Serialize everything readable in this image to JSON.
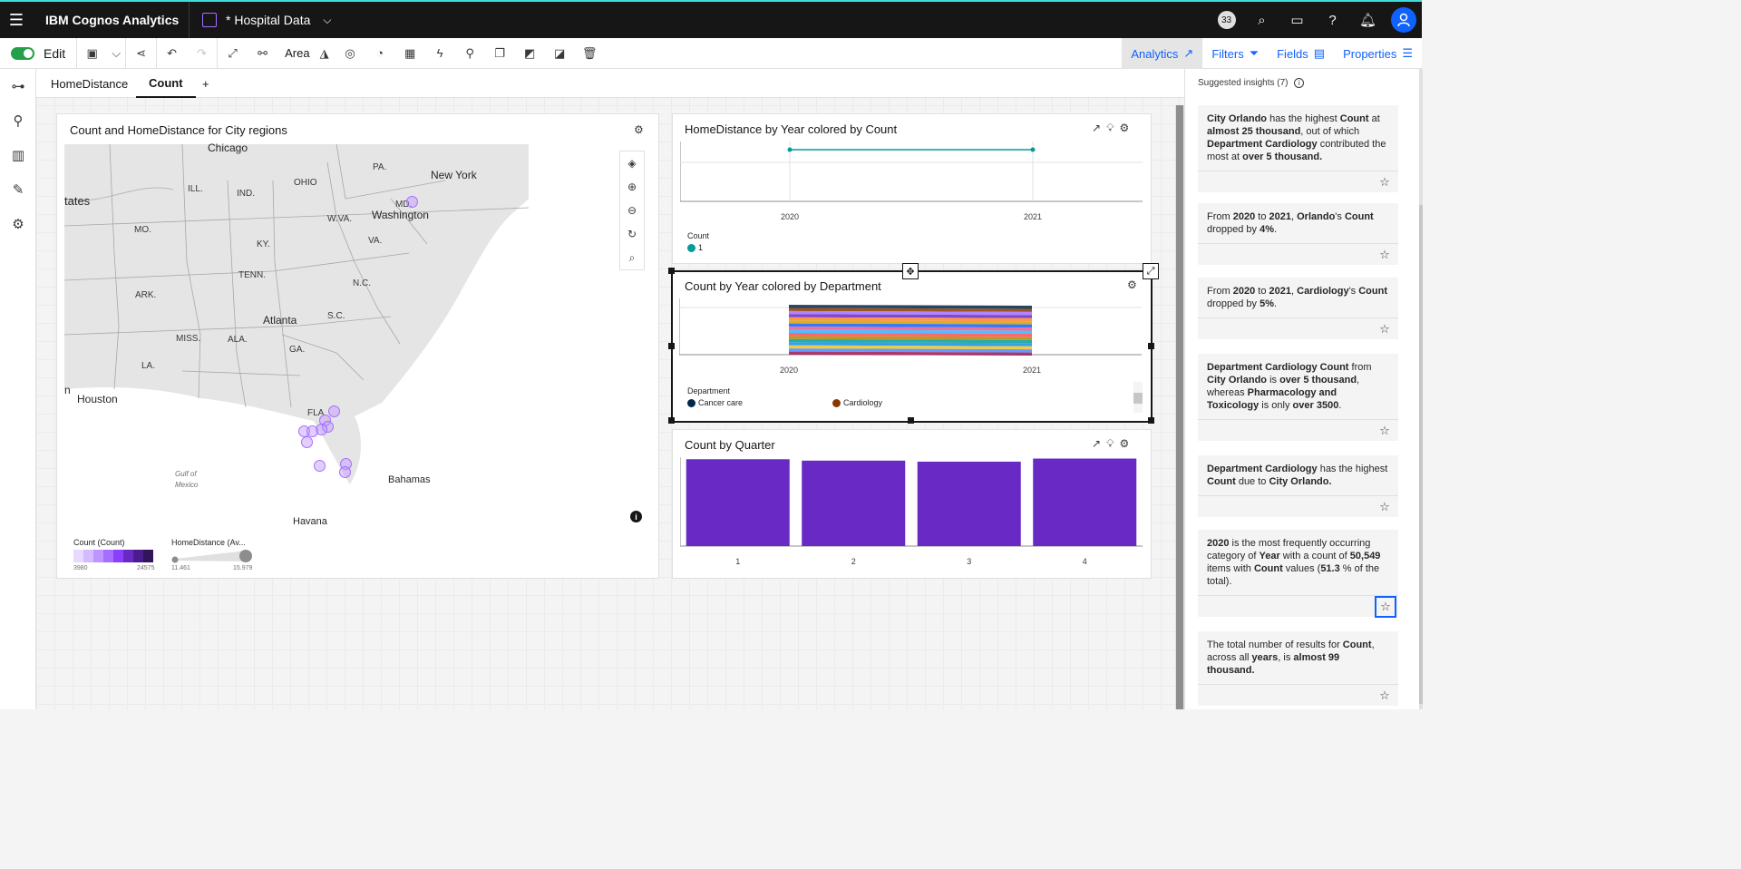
{
  "app": {
    "title": "IBM Cognos Analytics",
    "document": "* Hospital Data",
    "notifications_count": "33"
  },
  "toolbar": {
    "edit_label": "Edit",
    "area_label": "Area",
    "right_tabs": [
      "Analytics",
      "Filters",
      "Fields",
      "Properties"
    ]
  },
  "tabs": [
    {
      "label": "HomeDistance"
    },
    {
      "label": "Count"
    },
    {
      "label": "+"
    }
  ],
  "map_panel": {
    "title": "Count and HomeDistance for City regions",
    "labels": {
      "chicago": "Chicago",
      "pa": "PA.",
      "newyork": "New York",
      "ill": "ILL.",
      "ohio": "OHIO",
      "ind": "IND.",
      "md": "MD.",
      "states": "tates",
      "wva": "W.VA.",
      "washington": "Washington",
      "mo": "MO.",
      "ky": "KY.",
      "va": "VA.",
      "tenn": "TENN.",
      "nc": "N.C.",
      "ark": "ARK.",
      "atlanta": "Atlanta",
      "sc": "S.C.",
      "miss": "MISS.",
      "ala": "ALA.",
      "ga": "GA.",
      "la": "LA.",
      "houston": "Houston",
      "n": "n",
      "fla": "FLA.",
      "gulf": "Gulf of",
      "mexico": "Mexico",
      "bahamas": "Bahamas",
      "havana": "Havana"
    },
    "legend_count_title": "Count (Count)",
    "legend_count_min": "3980",
    "legend_count_max": "24575",
    "legend_home_title": "HomeDistance (Av...",
    "legend_home_min": "11.461",
    "legend_home_max": "15.979",
    "count_scale_colors": [
      "#e8daff",
      "#d4bbff",
      "#be95ff",
      "#a56eff",
      "#8a3ffc",
      "#6929c4",
      "#491d8b",
      "#31135e"
    ]
  },
  "chart_data": [
    {
      "type": "line",
      "title": "HomeDistance by Year colored by Count",
      "x": [
        "2020",
        "2021"
      ],
      "series": [
        {
          "name": "1",
          "values": [
            1,
            1
          ]
        }
      ],
      "legend_title": "Count",
      "color": "#009d9a"
    },
    {
      "type": "area",
      "title": "Count by Year colored by Department",
      "x": [
        "2020",
        "2021"
      ],
      "legend_title": "Department",
      "legend_entries": [
        {
          "name": "Cancer care",
          "color": "#012749"
        },
        {
          "name": "Cardiology",
          "color": "#8a3800"
        }
      ],
      "band_colors": [
        "#012749",
        "#8a3800",
        "#a56eff",
        "#6929c4",
        "#ff832b",
        "#d2a106",
        "#0f62fe",
        "#ee538b",
        "#33b1ff",
        "#fa4d56",
        "#b28600",
        "#009d9a",
        "#1192e8",
        "#f1c21b",
        "#4589ff",
        "#9f1853"
      ]
    },
    {
      "type": "bar",
      "title": "Count by Quarter",
      "categories": [
        "1",
        "2",
        "3",
        "4"
      ],
      "values": [
        25200,
        24800,
        24500,
        25400
      ],
      "ylim": [
        0,
        25800
      ],
      "color": "#6929c4"
    }
  ],
  "insights": {
    "header": "Suggested insights (7)",
    "cards": [
      {
        "html": "<b>City Orlando</b> has the highest <b>Count</b> at <b>almost 25 thousand</b>, out of which <b>Department Cardiology</b> contributed the most at <b>over 5 thousand.</b>"
      },
      {
        "html": "From <b>2020</b> to <b>2021</b>, <b>Orlando</b>'s <b>Count</b> dropped by <b>4%</b>."
      },
      {
        "html": "From <b>2020</b> to <b>2021</b>, <b>Cardiology</b>'s <b>Count</b> dropped by <b>5%</b>."
      },
      {
        "html": "<b>Department Cardiology Count</b> from <b>City Orlando</b> is <b>over 5 thousand</b>, whereas <b>Pharmacology and Toxicology</b> is only <b>over 3500</b>."
      },
      {
        "html": "<b>Department Cardiology</b> has the highest <b>Count</b> due to <b>City Orlando.</b>"
      },
      {
        "html": "<b>2020</b> is the most frequently occurring category of <b>Year</b> with a count of <b>50,549</b> items with <b>Count</b> values (<b>51.3</b> % of the total)."
      },
      {
        "html": "The total number of results for <b>Count</b>, across all <b>years</b>, is <b>almost 99 thousand.</b>"
      }
    ]
  }
}
